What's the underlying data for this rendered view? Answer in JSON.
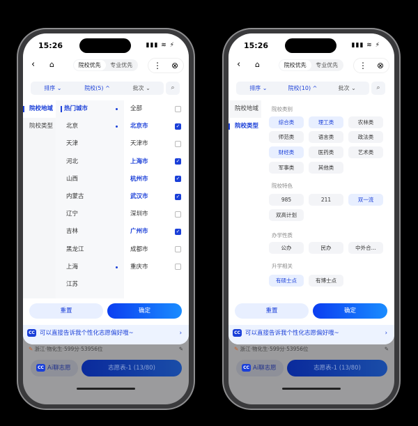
{
  "status": {
    "time": "15:26",
    "signal": "▮▮▮ ≋ ⚡"
  },
  "nav": {
    "seg": [
      "院校优先",
      "专业优先"
    ],
    "back_icon": "chevron-left",
    "home_icon": "home",
    "more_icon": "more-vertical",
    "close_icon": "close-circle"
  },
  "phone1": {
    "filters": [
      "排序 ⌄",
      "院校(5) ^",
      "批次 ⌄"
    ],
    "left": [
      "院校地域",
      "院校类型"
    ],
    "mid": [
      {
        "t": "热门城市",
        "sel": true,
        "dot": true
      },
      {
        "t": "北京",
        "dot": true
      },
      {
        "t": "天津"
      },
      {
        "t": "河北"
      },
      {
        "t": "山西"
      },
      {
        "t": "内蒙古"
      },
      {
        "t": "辽宁"
      },
      {
        "t": "吉林"
      },
      {
        "t": "黑龙江"
      },
      {
        "t": "上海",
        "dot": true
      },
      {
        "t": "江苏"
      }
    ],
    "right": [
      {
        "t": "全部",
        "c": false
      },
      {
        "t": "北京市",
        "c": true
      },
      {
        "t": "天津市",
        "c": false
      },
      {
        "t": "上海市",
        "c": true
      },
      {
        "t": "杭州市",
        "c": true
      },
      {
        "t": "武汉市",
        "c": true
      },
      {
        "t": "深圳市",
        "c": false
      },
      {
        "t": "广州市",
        "c": true
      },
      {
        "t": "成都市",
        "c": false
      },
      {
        "t": "重庆市",
        "c": false
      }
    ]
  },
  "phone2": {
    "filters": [
      "排序 ⌄",
      "院校(10) ^",
      "批次 ⌄"
    ],
    "left": [
      "院校地域",
      "院校类型"
    ],
    "sections": [
      {
        "label": "院校类别",
        "chips": [
          {
            "t": "综合类",
            "on": true
          },
          {
            "t": "理工类",
            "on": true
          },
          {
            "t": "农林类"
          },
          {
            "t": "师范类"
          },
          {
            "t": "语言类"
          },
          {
            "t": "政法类"
          },
          {
            "t": "财经类",
            "on": true
          },
          {
            "t": "医药类"
          },
          {
            "t": "艺术类"
          },
          {
            "t": "军事类"
          },
          {
            "t": "其他类"
          }
        ]
      },
      {
        "label": "院校特色",
        "chips": [
          {
            "t": "985"
          },
          {
            "t": "211"
          },
          {
            "t": "双一流",
            "on": true
          },
          {
            "t": "双高计划"
          }
        ]
      },
      {
        "label": "办学性质",
        "chips": [
          {
            "t": "公办"
          },
          {
            "t": "民办"
          },
          {
            "t": "中外合..."
          }
        ]
      },
      {
        "label": "升学相关",
        "chips": [
          {
            "t": "有硕士点",
            "on": true
          },
          {
            "t": "有博士点"
          }
        ]
      }
    ]
  },
  "buttons": {
    "reset": "重置",
    "confirm": "确定"
  },
  "banner": {
    "icon": "CC",
    "text": "可以直接告诉我个性化志愿偏好哦~",
    "arrow": "›"
  },
  "info": {
    "text": "浙江·物化生·599分·53956位",
    "edit_icon": "pencil"
  },
  "bottom": {
    "ai": "Ai聊志愿",
    "table": "志愿表-1 (13/80)"
  },
  "colors": {
    "accent": "#1a3fd8",
    "chip_on": "#e8efff"
  }
}
